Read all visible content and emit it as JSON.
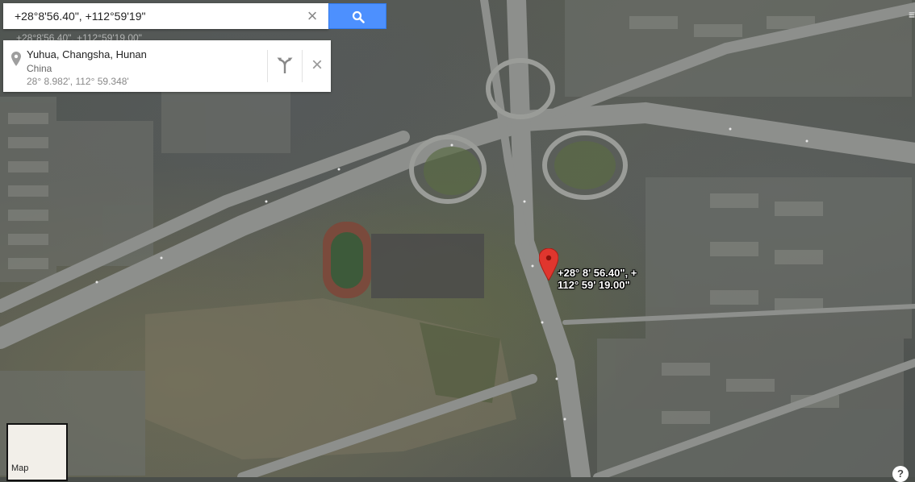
{
  "search": {
    "query": "+28°8'56.40\", +112°59'19\"",
    "ghost_coords": "+28°8'56.40\", +112°59'19.00\""
  },
  "place": {
    "title": "Yuhua, Changsha, Hunan",
    "country": "China",
    "coords": "28° 8.982', 112° 59.348'"
  },
  "marker": {
    "line1": "+28° 8' 56.40\", +",
    "line2": "112° 59' 19.00\""
  },
  "map_toggle": {
    "label": "Map"
  },
  "help": {
    "label": "?"
  },
  "colors": {
    "search_button": "#4d90fe",
    "marker": "#e0362e"
  },
  "icons": [
    "hamburger-icon",
    "clear-icon",
    "search-icon",
    "place-pin-icon",
    "directions-icon",
    "close-icon",
    "map-marker-icon",
    "help-icon"
  ]
}
